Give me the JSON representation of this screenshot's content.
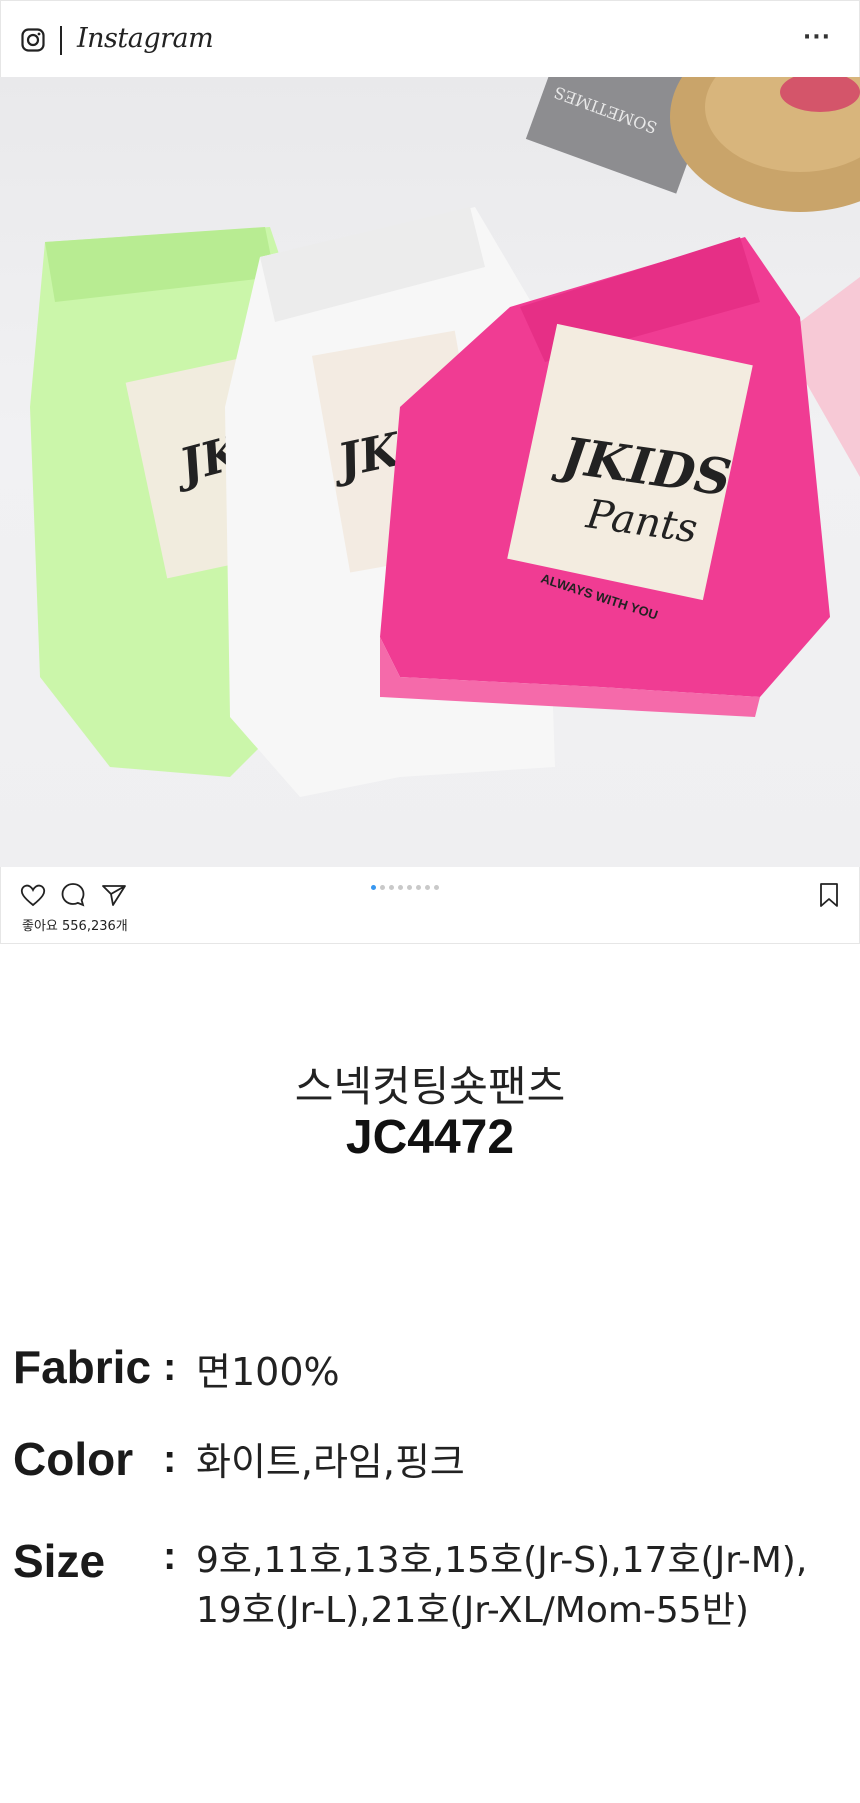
{
  "header": {
    "wordmark": "Instagram",
    "icons": {
      "logo": "instagram-camera-icon",
      "more": "more-horizontal-icon"
    },
    "more_label": "···"
  },
  "photo": {
    "description_labels": {
      "patch_text_line1": "JKIDS",
      "patch_text_line2": "Pants",
      "patch_tagline": "ALWAYS WITH YOU",
      "card_text": "SOMETIMES"
    }
  },
  "actions": {
    "icons": {
      "like": "heart-icon",
      "comment": "comment-icon",
      "share": "send-icon",
      "save": "bookmark-icon"
    },
    "carousel_total": 8,
    "carousel_active": 1,
    "likes_text": "좋아요 556,236개"
  },
  "product": {
    "name_ko": "스넥컷팅숏팬츠",
    "code": "JC4472"
  },
  "specs": [
    {
      "label": "Fabric",
      "value": "면100%"
    },
    {
      "label": "Color",
      "value": "화이트,라임,핑크"
    },
    {
      "label": "Size",
      "value_line1": "9호,11호,13호,15호(Jr-S),17호(Jr-M),",
      "value_line2": "19호(Jr-L),21호(Jr-XL/Mom-55반)"
    }
  ],
  "colors": {
    "accent_dot": "#3897f0",
    "lime": "#c9f5a8",
    "white_denim": "#f4f4f4",
    "pink": "#f03c93"
  }
}
